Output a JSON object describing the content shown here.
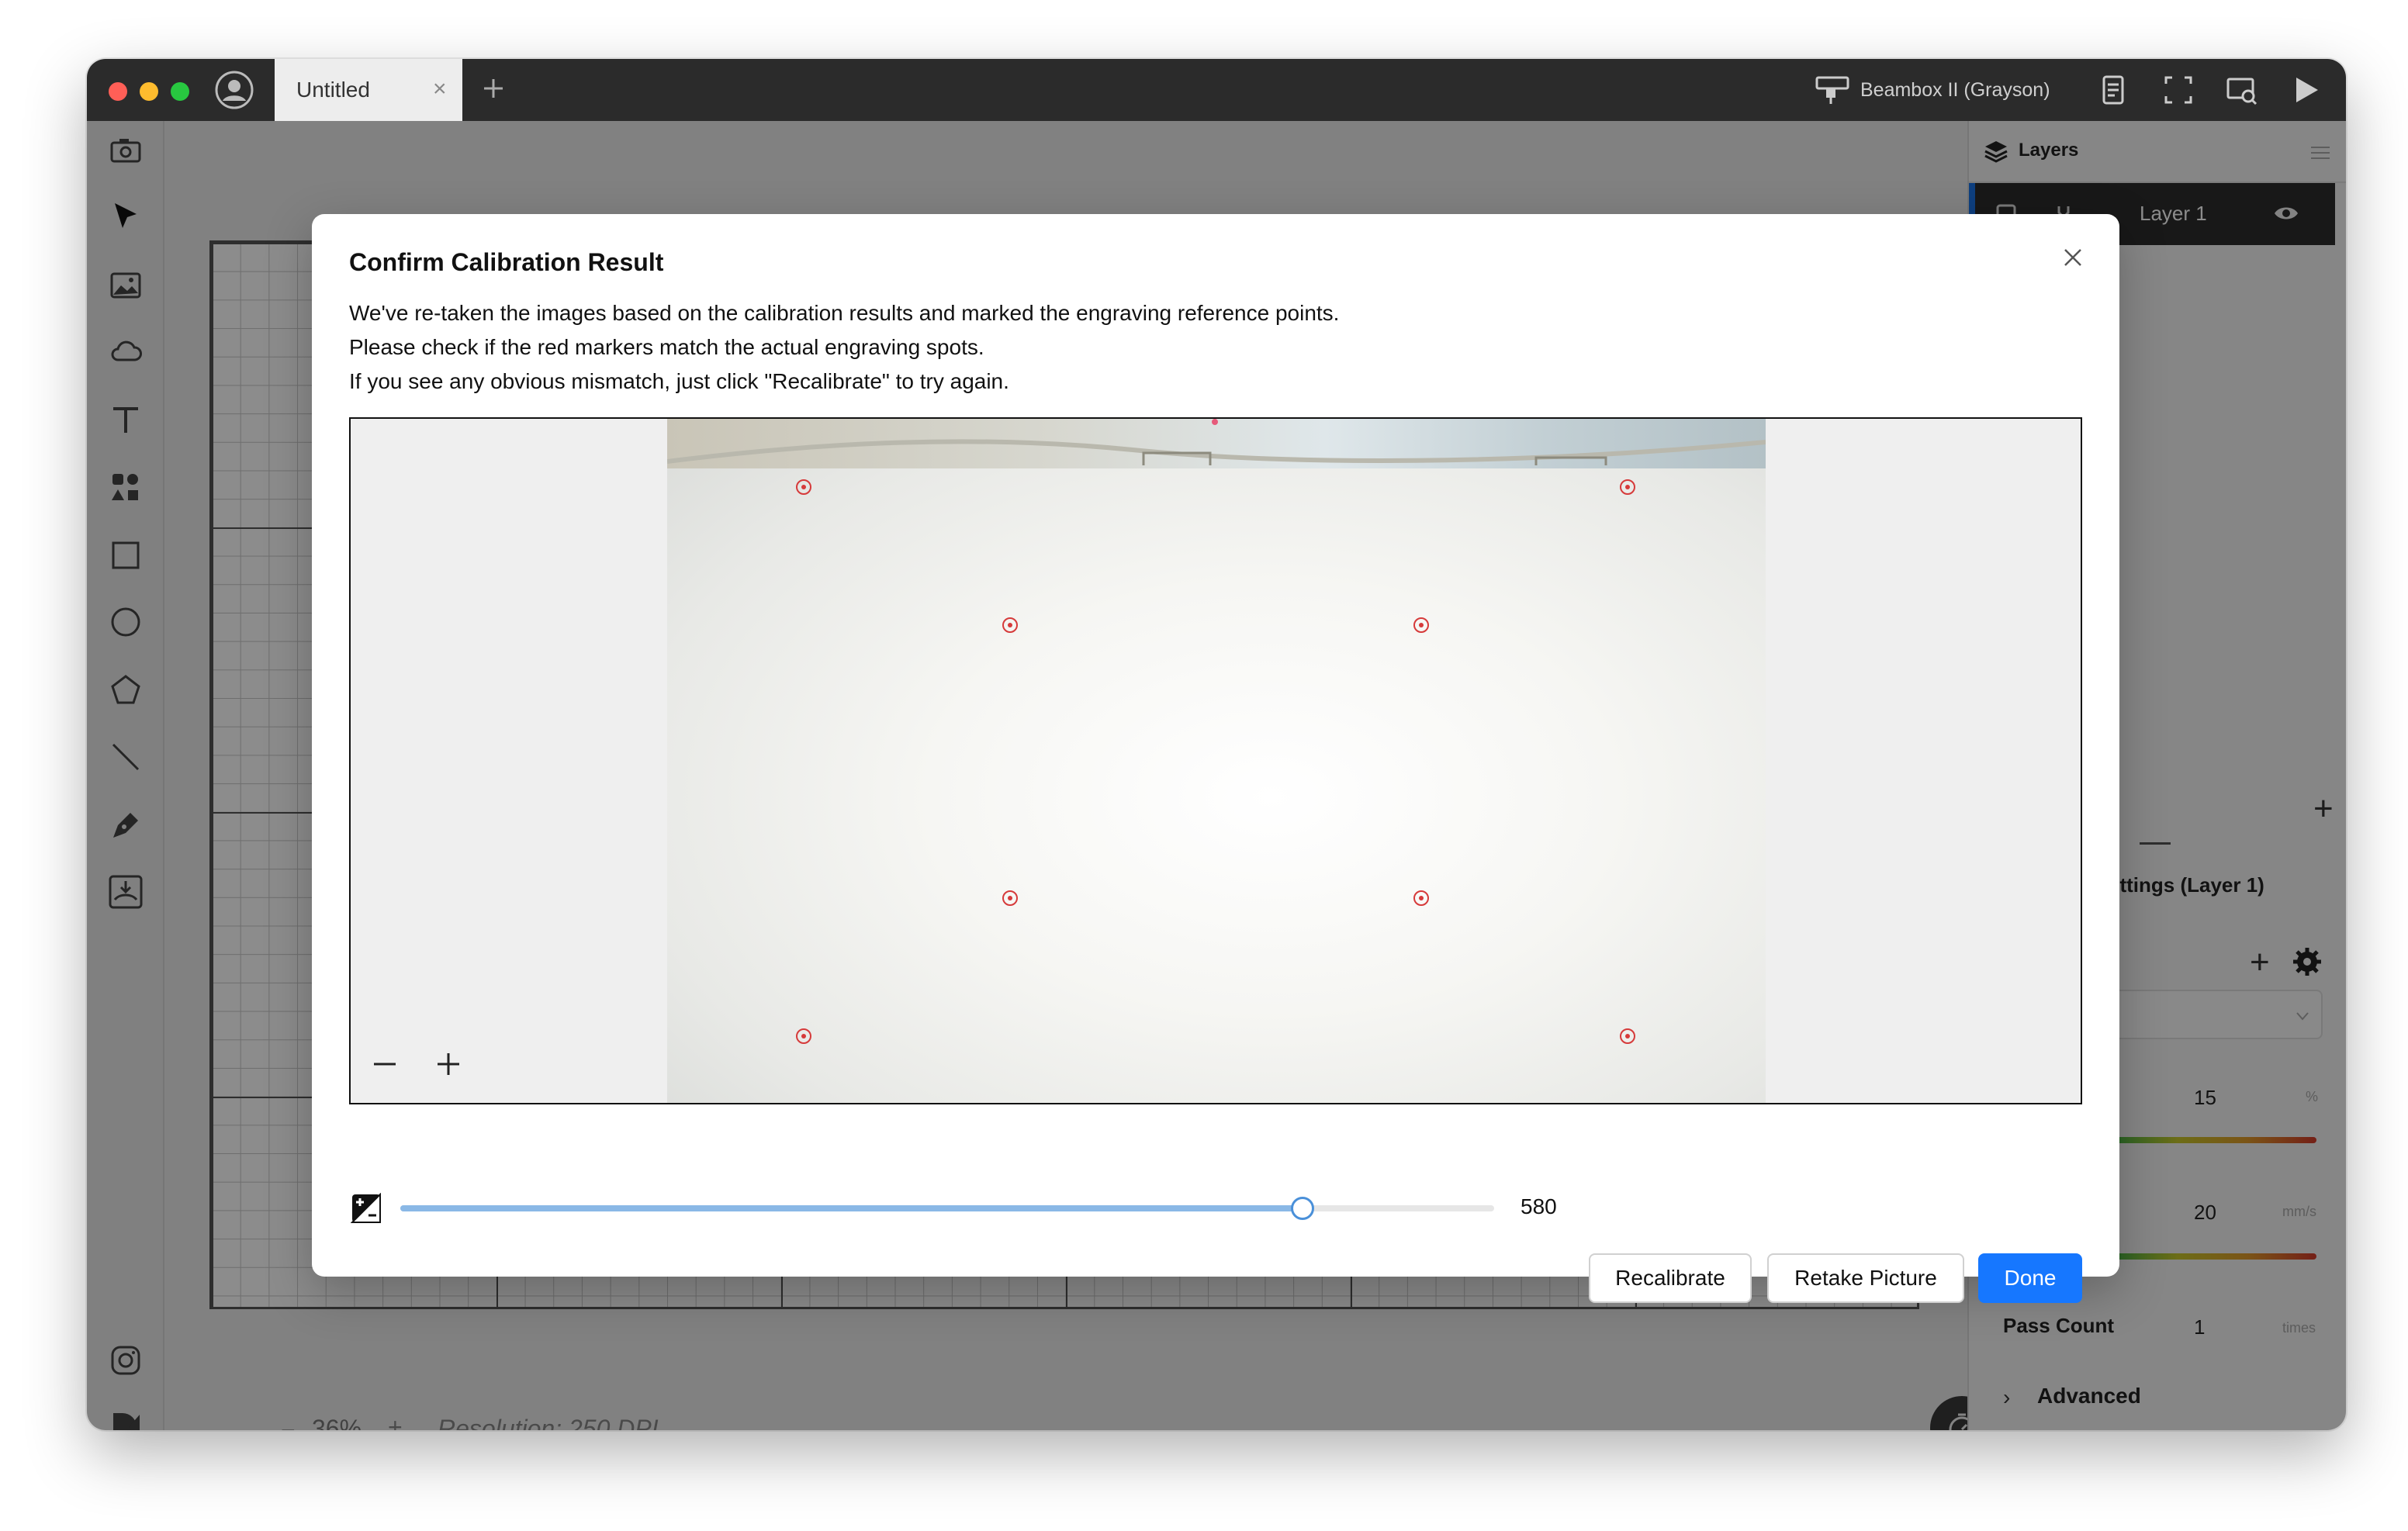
{
  "window": {
    "tab_title": "Untitled",
    "tab_close": "×",
    "device_name": "Beambox II (Grayson)"
  },
  "canvas": {
    "zoom_minus": "−",
    "zoom_value": "36%",
    "zoom_plus": "+",
    "resolution": "Resolution: 250 DPI"
  },
  "layers_panel": {
    "title": "Layers",
    "layer_name": "Layer 1",
    "settings_title": "ettings (Layer 1)",
    "power_value": "15",
    "power_unit": "%",
    "speed_value": "20",
    "speed_unit": "mm/s",
    "pass_label": "Pass Count",
    "pass_value": "1",
    "pass_unit": "times",
    "advanced_label": "Advanced"
  },
  "dialog": {
    "title": "Confirm Calibration Result",
    "lines": [
      "We've re-taken the images based on the calibration results and marked the engraving reference points.",
      "Please check if the red markers match the actual engraving spots.",
      "If you see any obvious mismatch, just click \"Recalibrate\" to try again."
    ],
    "exposure_value": 580,
    "exposure_fraction": 0.825,
    "value_label": "580",
    "buttons": {
      "recalibrate": "Recalibrate",
      "retake": "Retake Picture",
      "done": "Done"
    }
  },
  "colors": {
    "accent": "#1677ff",
    "marker": "#d63a3a",
    "titlebar": "#2b2b2b"
  }
}
